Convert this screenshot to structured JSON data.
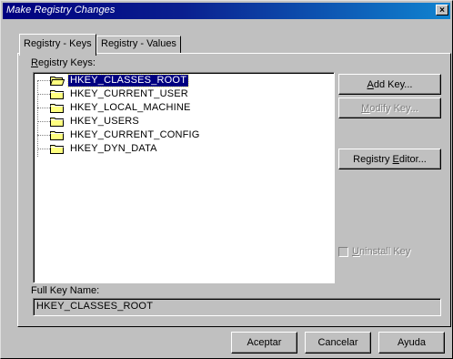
{
  "window": {
    "title": "Make Registry Changes",
    "close_glyph": "×"
  },
  "tabs": [
    {
      "label": "Registry - Keys",
      "active": true
    },
    {
      "label": "Registry - Values",
      "active": false
    }
  ],
  "keys_panel": {
    "keys_label_accel": "R",
    "keys_label_rest": "egistry Keys:",
    "tree": [
      {
        "name": "HKEY_CLASSES_ROOT",
        "selected": true,
        "icon": "folder-open-icon"
      },
      {
        "name": "HKEY_CURRENT_USER",
        "selected": false,
        "icon": "folder-icon"
      },
      {
        "name": "HKEY_LOCAL_MACHINE",
        "selected": false,
        "icon": "folder-icon"
      },
      {
        "name": "HKEY_USERS",
        "selected": false,
        "icon": "folder-icon"
      },
      {
        "name": "HKEY_CURRENT_CONFIG",
        "selected": false,
        "icon": "folder-icon"
      },
      {
        "name": "HKEY_DYN_DATA",
        "selected": false,
        "icon": "folder-icon"
      }
    ],
    "add_key": {
      "accel": "A",
      "rest": "dd Key..."
    },
    "modify_key": {
      "accel": "M",
      "rest": "odify Key...",
      "disabled": true
    },
    "registry_editor": {
      "pre": "Registry ",
      "accel": "E",
      "rest": "ditor..."
    },
    "uninstall_key": {
      "accel": "U",
      "rest": "ninstall Key",
      "checked": false,
      "disabled": true
    },
    "full_key_label": "Full Key Name:",
    "full_key_value": "HKEY_CLASSES_ROOT"
  },
  "footer": {
    "ok_label": "Aceptar",
    "cancel_label": "Cancelar",
    "help_label": "Ayuda"
  },
  "colors": {
    "title_start": "#000080",
    "title_end": "#1084d0",
    "face": "#c0c0c0",
    "selection": "#000080",
    "folder": "#ffff80"
  }
}
